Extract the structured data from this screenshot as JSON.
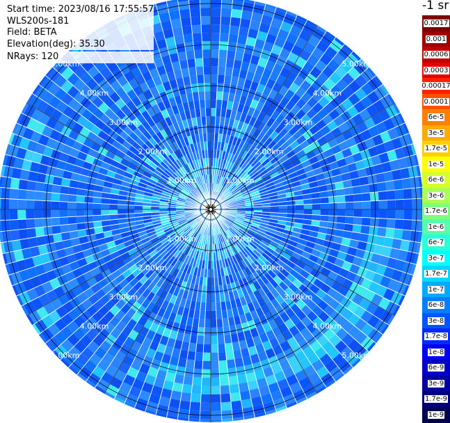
{
  "info": {
    "start_time": "Start time: 2023/08/16 17:55:57",
    "instrument": "WLS200s-181",
    "field": "Field: BETA",
    "elevation": "Elevation(deg): 35.30",
    "nrays": "NRays: 120"
  },
  "colorbar": {
    "unit": "-1 sr",
    "labels": [
      "0.0017",
      "0.001",
      "0.0006",
      "0.0003",
      "0.00017",
      "0.0001",
      "6e-5",
      "3e-5",
      "1.7e-5",
      "1e-5",
      "6e-6",
      "3e-6",
      "1.7e-6",
      "1e-6",
      "6e-7",
      "3e-7",
      "1.7e-7",
      "1e-7",
      "6e-8",
      "3e-8",
      "1.7e-8",
      "1e-8",
      "6e-9",
      "3e-9",
      "1.7e-9",
      "1e-9"
    ],
    "colors": [
      "#7f0000",
      "#9e0000",
      "#c20000",
      "#e60000",
      "#ff2000",
      "#ff5000",
      "#ff8000",
      "#ffaa00",
      "#ffd000",
      "#ffff00",
      "#d8ff26",
      "#aaff55",
      "#7fff7f",
      "#55ffaa",
      "#26ffd8",
      "#00ffff",
      "#00d8ff",
      "#00aaff",
      "#0080ff",
      "#0055ff",
      "#002aff",
      "#0000f0",
      "#0000c8",
      "#0000a0",
      "#00007f",
      "#000050"
    ]
  },
  "chart_data": {
    "type": "heatmap",
    "projection": "polar-ppi",
    "rays": 120,
    "range_max_km": 5.0,
    "range_rings_km": [
      1,
      2,
      3,
      4,
      5
    ],
    "ring_labels": [
      "1.00km",
      "2.00km",
      "3.00km",
      "4.00km",
      "5.00km"
    ],
    "spokes_every_deg": 30,
    "field": "BETA",
    "elevation_deg": 35.3,
    "background_level": "1e-8 to 6e-8",
    "features": [
      {
        "name": "near-range-core",
        "range_km": [
          0,
          1.0
        ],
        "level": "1e-7"
      },
      {
        "name": "enhanced-arc",
        "range_km": [
          3.7,
          4.4
        ],
        "azimuth_deg": [
          95,
          200
        ],
        "level": "1.7e-7"
      }
    ],
    "grid": true
  }
}
